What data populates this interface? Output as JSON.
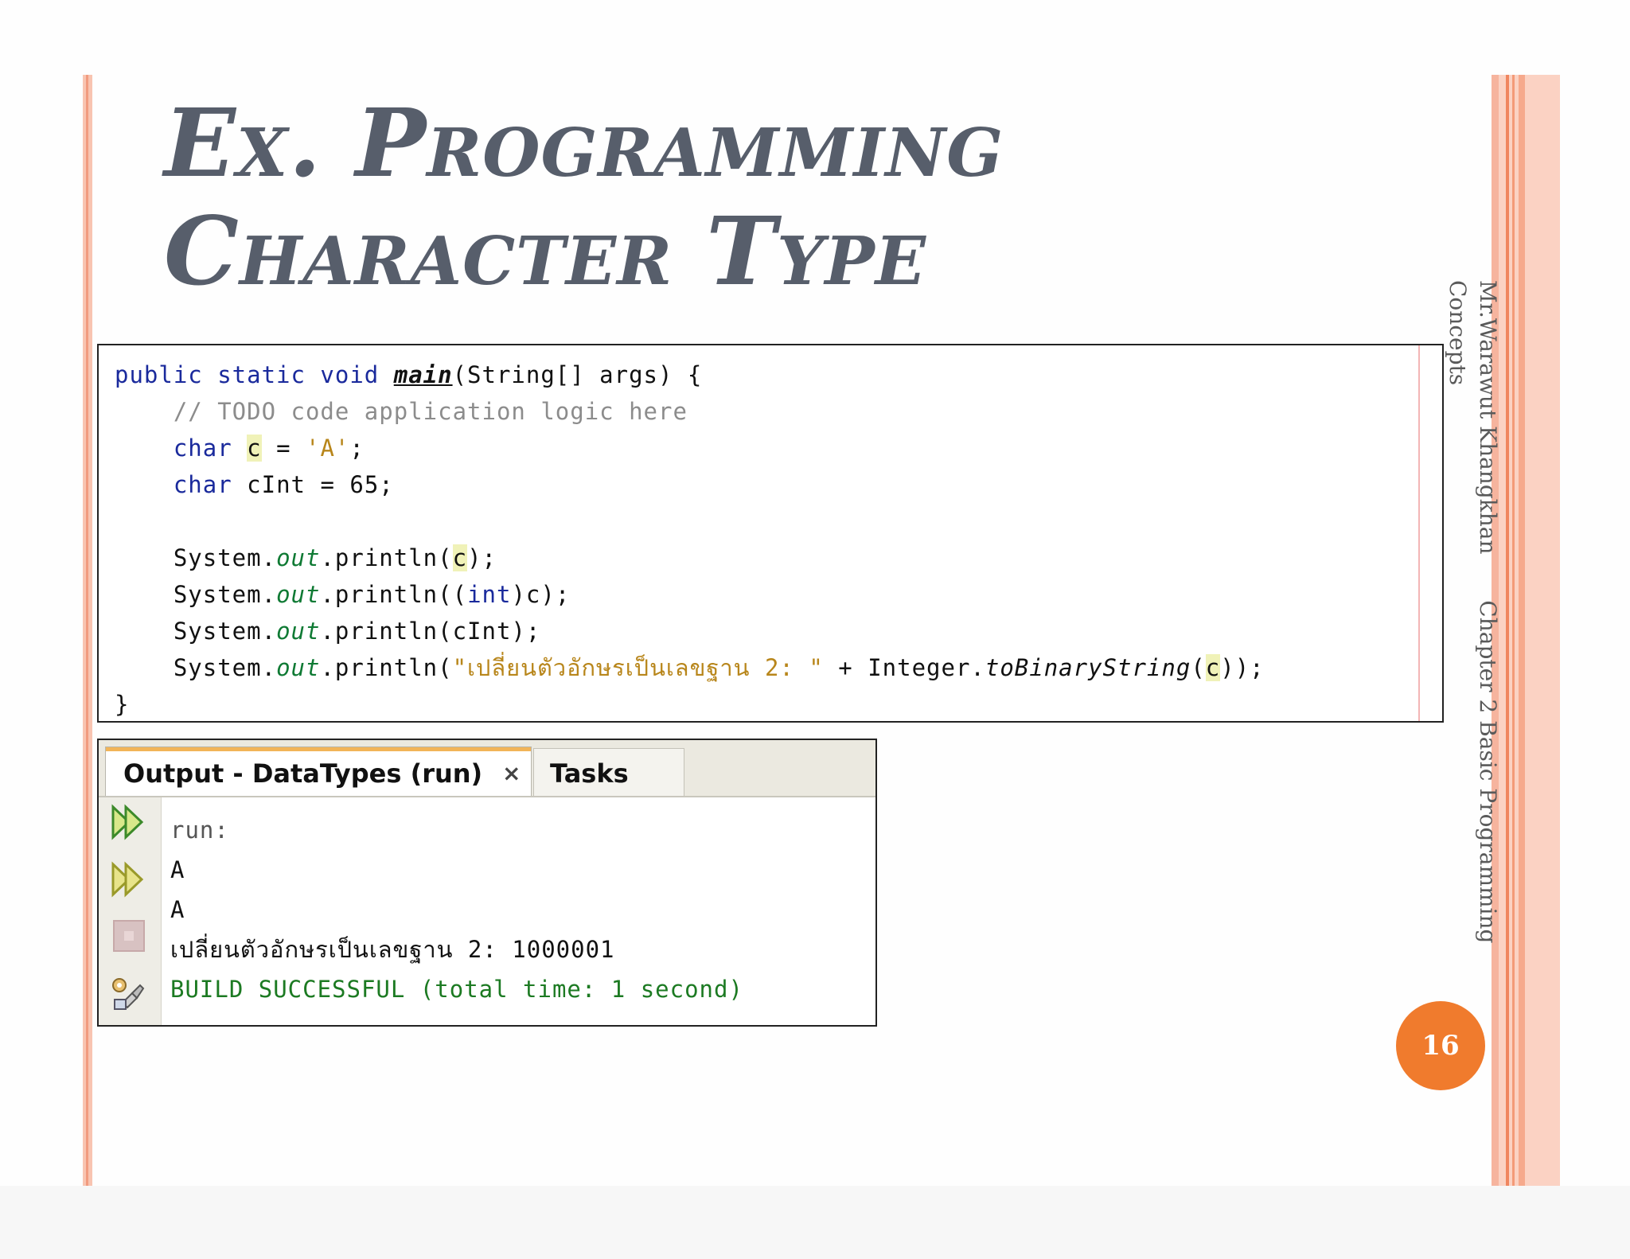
{
  "slide": {
    "title_line1": "Ex. Programming",
    "title_line2": "Character Type",
    "author": "Mr.Warawut Khangkhan",
    "chapter": "Chapter 2 Basic Programming Concepts",
    "page_number": "16"
  },
  "code": {
    "l1_kw": "public static void ",
    "l1_main": "main",
    "l1_rest": "(String[] args) {",
    "l2_comment": "    // TODO code application logic here",
    "l3_indent": "    ",
    "l3_kw": "char",
    "l3_sp": " ",
    "l3_var": "c",
    "l3_eq": " = ",
    "l3_str": "'A'",
    "l3_end": ";",
    "l4_indent": "    ",
    "l4_kw": "char",
    "l4_rest": " cInt = 65;",
    "l6_pre": "    System.",
    "l6_out": "out",
    "l6_mid": ".println(",
    "l6_var": "c",
    "l6_end": ");",
    "l7_pre": "    System.",
    "l7_out": "out",
    "l7_mid": ".println((",
    "l7_kw": "int",
    "l7_end": ")c);",
    "l8_pre": "    System.",
    "l8_out": "out",
    "l8_end": ".println(cInt);",
    "l9_pre": "    System.",
    "l9_out": "out",
    "l9_mid": ".println(",
    "l9_str": "\"เปลี่ยนตัวอักษรเป็นเลขฐาน 2: \"",
    "l9_plus": " + Integer.",
    "l9_method": "toBinaryString",
    "l9_open": "(",
    "l9_var": "c",
    "l9_end": "));",
    "l10": "}"
  },
  "output_panel": {
    "tab_output": "Output - DataTypes (run)",
    "tab_close": "×",
    "tab_tasks": "Tasks",
    "lines": [
      "run:",
      "A",
      "A",
      "เปลี่ยนตัวอักษรเป็นเลขฐาน 2: 1000001",
      "BUILD SUCCESSFUL (total time: 1 second)"
    ]
  },
  "colors": {
    "accent_orange": "#f07b2d",
    "title_gray": "#575e6b",
    "keyword_blue": "#1a2a9c",
    "string_gold": "#b8861b",
    "success_green": "#1c7a22"
  },
  "icons": [
    "run-again-icon",
    "rerun-icon",
    "stop-icon",
    "settings-icon"
  ]
}
